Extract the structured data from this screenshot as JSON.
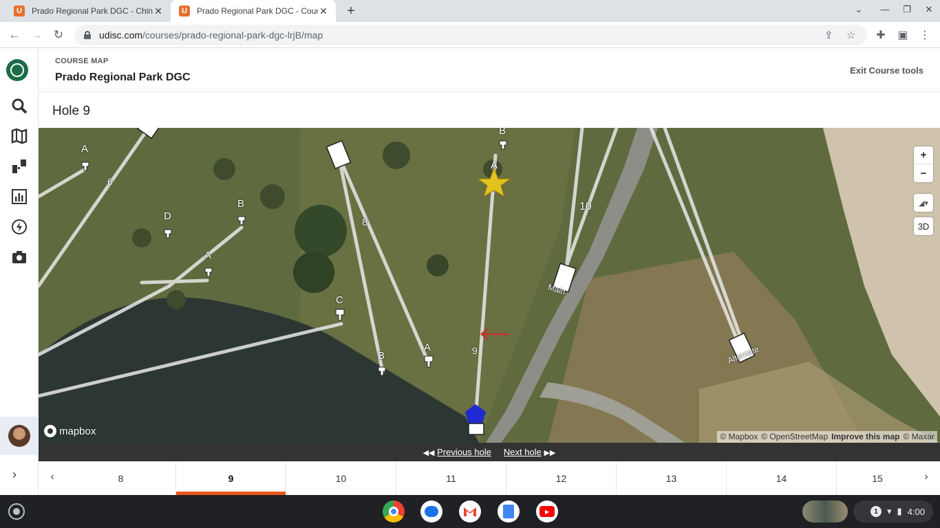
{
  "browser": {
    "tabs": [
      {
        "title": "Prado Regional Park DGC - Chino Hills",
        "active": false
      },
      {
        "title": "Prado Regional Park DGC - Course map",
        "active": true
      }
    ],
    "url_host": "udisc.com",
    "url_path": "/courses/prado-regional-park-dgc-lrjB/map"
  },
  "sidebar": {
    "icons": [
      "udisc-logo-icon",
      "search-icon",
      "map-icon",
      "scorecard-icon",
      "stats-icon",
      "lightning-icon",
      "camera-icon"
    ]
  },
  "header": {
    "kicker": "COURSE MAP",
    "course_name": "Prado Regional Park DGC",
    "exit_label": "Exit Course tools"
  },
  "hole": {
    "title": "Hole 9"
  },
  "map": {
    "labels": {
      "hole6": "6",
      "hole8": "8",
      "hole9": "9",
      "hole10": "10",
      "tee_main": "Main",
      "tee_alt": "Alternate",
      "pin_a": "A",
      "pin_b": "B",
      "pin_c": "C",
      "pin_d": "D"
    },
    "zoom_in": "+",
    "zoom_out": "−",
    "toggle_3d": "3D",
    "logo": "mapbox",
    "attribution": {
      "mapbox": "© Mapbox",
      "osm": "© OpenStreetMap",
      "improve": "Improve this map",
      "maxar": "© Maxar"
    }
  },
  "nav": {
    "previous": "Previous hole",
    "next": "Next hole"
  },
  "holes": {
    "numbers": [
      "8",
      "9",
      "10",
      "11",
      "12",
      "13",
      "14",
      "15"
    ],
    "active": "9"
  },
  "shelf": {
    "notification_count": "1",
    "time": "4:00"
  }
}
